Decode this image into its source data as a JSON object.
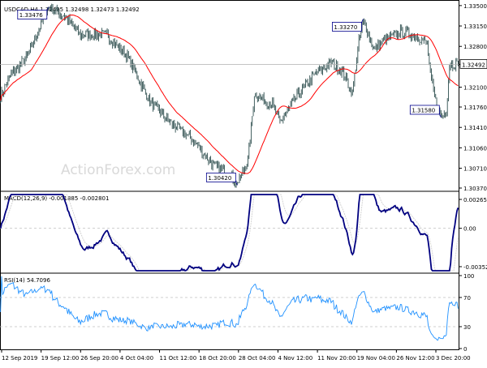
{
  "chart_data": {
    "type": "line",
    "symbol": "USDCAD,H4",
    "ohlc": [
      "1.32495",
      "1.32498",
      "1.32473",
      "1.32492"
    ],
    "colors": {
      "price": "#2f4f4f",
      "ma": "#ff0000",
      "macd": "#000080",
      "signal": "#d3d3d3",
      "rsi": "#1e90ff",
      "grid": "#c0c0c0",
      "marker_border": "#00008b",
      "watermark": "#d9d9d9"
    },
    "watermark": "ActionForex.com",
    "price_panel": {
      "ylim": [
        1.3037,
        1.3354
      ],
      "ticks": [
        "1.33500",
        "1.33150",
        "1.32800",
        "1.32492",
        "1.32100",
        "1.31760",
        "1.31410",
        "1.31060",
        "1.30710",
        "1.30370"
      ],
      "last_price": 1.32492,
      "last_price_label": "1.32492",
      "annotations": [
        {
          "label": "1.33476",
          "value": 1.33476,
          "bar": 45
        },
        {
          "label": "1.33270",
          "value": 1.3327,
          "bar": 340
        },
        {
          "label": "1.30420",
          "value": 1.3042,
          "bar": 222
        },
        {
          "label": "1.31580",
          "value": 1.3158,
          "bar": 413
        }
      ]
    },
    "macd_panel": {
      "label": "MACD(12,26,9) -0.001885 -0.002801",
      "ylim": [
        -0.0039,
        0.0031
      ],
      "ticks": [
        "0.002652",
        "0.00",
        "-0.003526"
      ],
      "macd_value": -0.001885,
      "signal_value": -0.002801
    },
    "rsi_panel": {
      "label": "RSI(14) 54.7096",
      "ylim": [
        0,
        100
      ],
      "ticks": [
        "100",
        "70",
        "30",
        "0"
      ],
      "levels": [
        70,
        30
      ],
      "value": 54.7096
    },
    "x_ticks": [
      "12 Sep 2019",
      "19 Sep 12:00",
      "26 Sep 20:00",
      "4 Oct 04:00",
      "11 Oct 12:00",
      "18 Oct 20:00",
      "28 Oct 04:00",
      "4 Nov 12:00",
      "11 Nov 20:00",
      "19 Nov 04:00",
      "26 Nov 12:00",
      "3 Dec 20:00"
    ],
    "price_anchors": [
      [
        0,
        1.3195
      ],
      [
        10,
        1.3232
      ],
      [
        25,
        1.3262
      ],
      [
        45,
        1.3348
      ],
      [
        60,
        1.3332
      ],
      [
        75,
        1.33
      ],
      [
        100,
        1.33
      ],
      [
        120,
        1.326
      ],
      [
        140,
        1.3185
      ],
      [
        160,
        1.3148
      ],
      [
        180,
        1.312
      ],
      [
        200,
        1.3075
      ],
      [
        215,
        1.3062
      ],
      [
        222,
        1.3042
      ],
      [
        232,
        1.3085
      ],
      [
        238,
        1.3198
      ],
      [
        255,
        1.318
      ],
      [
        262,
        1.315
      ],
      [
        280,
        1.32
      ],
      [
        295,
        1.3232
      ],
      [
        310,
        1.3252
      ],
      [
        320,
        1.3238
      ],
      [
        330,
        1.32
      ],
      [
        336,
        1.3288
      ],
      [
        340,
        1.3327
      ],
      [
        350,
        1.3275
      ],
      [
        360,
        1.329
      ],
      [
        375,
        1.3305
      ],
      [
        390,
        1.3298
      ],
      [
        400,
        1.3285
      ],
      [
        403,
        1.3232
      ],
      [
        407,
        1.3192
      ],
      [
        413,
        1.3158
      ],
      [
        418,
        1.317
      ],
      [
        421,
        1.3249
      ]
    ]
  }
}
